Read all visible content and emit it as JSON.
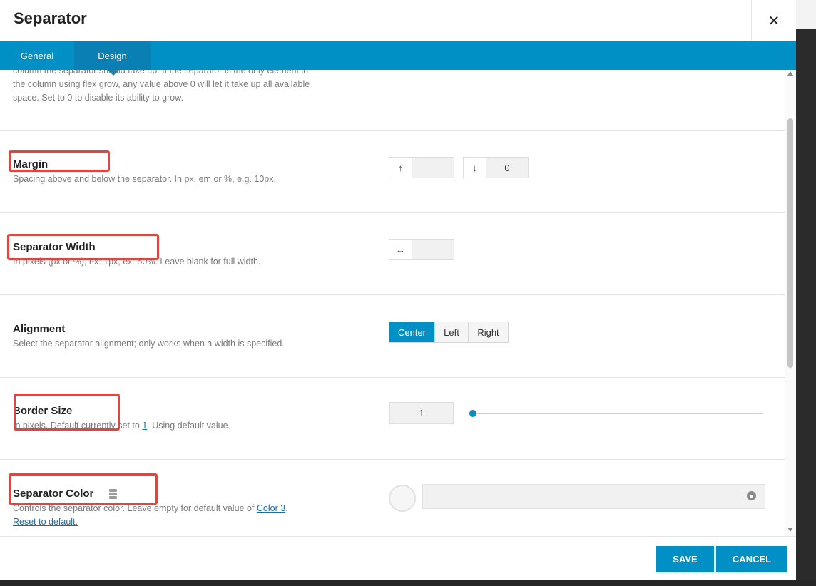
{
  "header": {
    "title": "Separator",
    "close_symbol": "✕"
  },
  "tabs": [
    {
      "label": "General",
      "active": false
    },
    {
      "label": "Design",
      "active": true
    }
  ],
  "top_partial_desc": "column the separator should take up. If the separator is the only element in the column using flex grow, any value above 0 will let it take up all available space. Set to 0 to disable its ability to grow.",
  "margin": {
    "label": "Margin",
    "desc": "Spacing above and below the separator. In px, em or %, e.g. 10px.",
    "top_value": "",
    "bottom_value": "0",
    "up_icon": "↑",
    "down_icon": "↓"
  },
  "separator_width": {
    "label": "Separator Width",
    "desc": "In pixels (px or %), ex: 1px, ex: 50%. Leave blank for full width.",
    "value": "",
    "icon": "↔"
  },
  "alignment": {
    "label": "Alignment",
    "desc": "Select the separator alignment; only works when a width is specified.",
    "options": [
      "Center",
      "Left",
      "Right"
    ],
    "selected": "Center"
  },
  "border_size": {
    "label": "Border Size",
    "desc_before": "In pixels. Default currently set to ",
    "desc_link": "1",
    "desc_after": ". Using default value.",
    "value": "1",
    "slider_fraction": 0.0
  },
  "separator_color": {
    "label": "Separator Color",
    "desc_before": "Controls the separator color. Leave empty for default value of ",
    "desc_link": "Color 3",
    "desc_after": ".",
    "reset_link": "Reset to default.",
    "value": ""
  },
  "footer": {
    "save_label": "SAVE",
    "cancel_label": "CANCEL"
  },
  "colors": {
    "accent": "#0090c5",
    "highlight": "#e0463f"
  }
}
